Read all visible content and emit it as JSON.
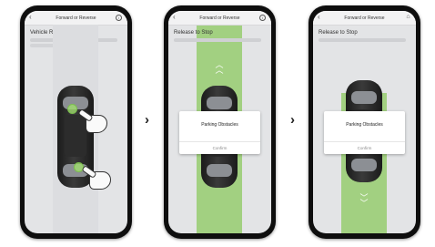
{
  "chevron": "›",
  "back_glyph": "‹",
  "screens": [
    {
      "header_title": "Forward or Reverse",
      "header_icon": "i",
      "title": "Vehicle Ready"
    },
    {
      "header_title": "Forward or Reverse",
      "header_icon": "i",
      "title": "Release to Stop",
      "up_arrows": "︿\n︿",
      "dialog": {
        "message": "Parking Obstacles",
        "confirm": "Confirm"
      }
    },
    {
      "header_title": "Forward or Reverse",
      "header_icon": "⌂",
      "title": "Release to Stop",
      "down_arrows": "﹀\n﹀",
      "dialog": {
        "message": "Parking Obstacles",
        "confirm": "Confirm"
      }
    }
  ],
  "colors": {
    "green_lane": "#96cd6e",
    "phone_frame": "#0e0e0e",
    "screen_bg": "#e3e4e6"
  }
}
